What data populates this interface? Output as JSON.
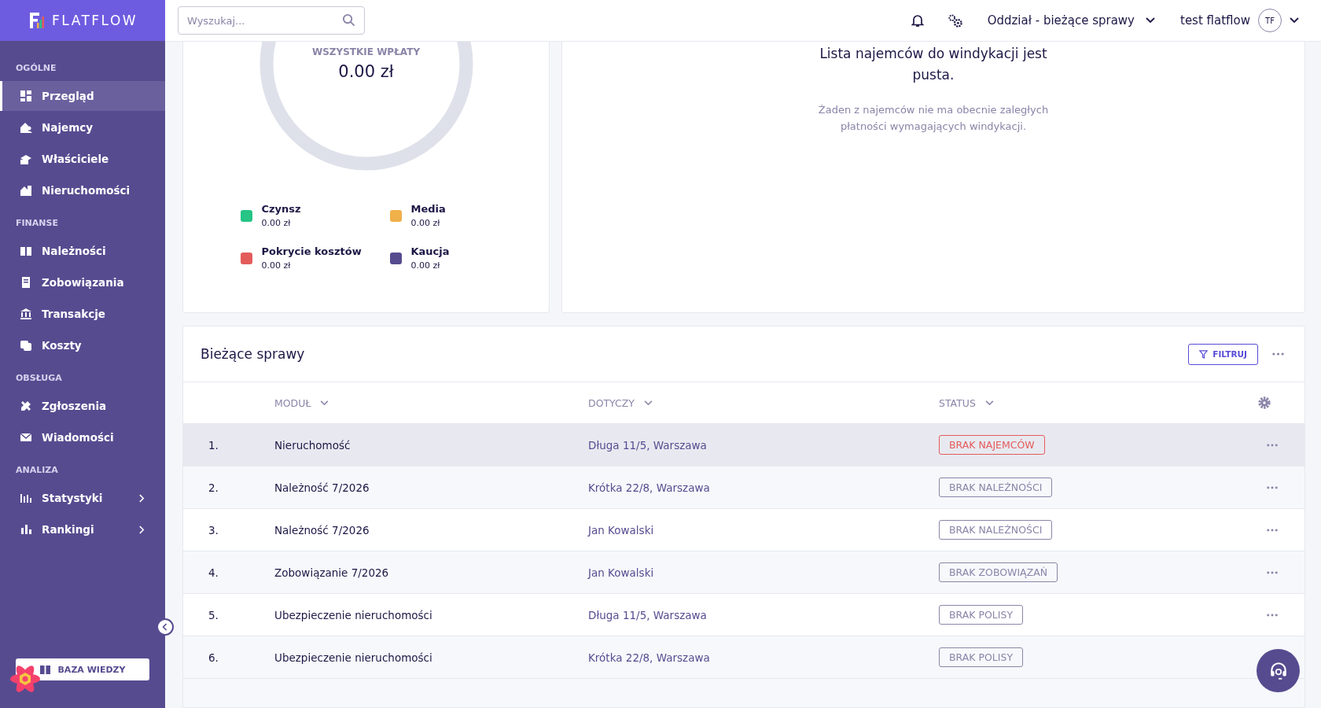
{
  "brand": "FLATFLOW",
  "sidebar": {
    "sections": [
      {
        "title": "OGÓLNE",
        "items": [
          {
            "label": "Przegląd",
            "selected": true,
            "submenu": false
          },
          {
            "label": "Najemcy",
            "selected": false,
            "submenu": false
          },
          {
            "label": "Właściciele",
            "selected": false,
            "submenu": false
          },
          {
            "label": "Nieruchomości",
            "selected": false,
            "submenu": false
          }
        ]
      },
      {
        "title": "FINANSE",
        "items": [
          {
            "label": "Należności",
            "selected": false,
            "submenu": false
          },
          {
            "label": "Zobowiązania",
            "selected": false,
            "submenu": false
          },
          {
            "label": "Transakcje",
            "selected": false,
            "submenu": false
          },
          {
            "label": "Koszty",
            "selected": false,
            "submenu": false
          }
        ]
      },
      {
        "title": "OBSŁUGA",
        "items": [
          {
            "label": "Zgłoszenia",
            "selected": false,
            "submenu": false
          },
          {
            "label": "Wiadomości",
            "selected": false,
            "submenu": false
          }
        ]
      },
      {
        "title": "ANALIZA",
        "items": [
          {
            "label": "Statystyki",
            "selected": false,
            "submenu": true
          },
          {
            "label": "Rankingi",
            "selected": false,
            "submenu": true
          }
        ]
      }
    ],
    "knowledge_button": "BAZA WIEDZY"
  },
  "topbar": {
    "search": {
      "placeholder": "Wyszukaj..."
    },
    "branch": "Oddział - bieżące sprawy",
    "user": "test flatflow",
    "avatar": "TF"
  },
  "payments": {
    "label": "WSZYSTKIE WPŁATY",
    "total": "0.00 zł",
    "legend": [
      {
        "name": "Czynsz",
        "amount": "0.00 zł",
        "color": "#26c485"
      },
      {
        "name": "Media",
        "amount": "0.00 zł",
        "color": "#f0b04a"
      },
      {
        "name": "Pokrycie kosztów",
        "amount": "0.00 zł",
        "color": "#e45b5b"
      },
      {
        "name": "Kaucja",
        "amount": "0.00 zł",
        "color": "#574b90"
      }
    ]
  },
  "collection": {
    "title": "Lista najemców do windykacji jest pusta.",
    "message": "Żaden z najemców nie ma obecnie zaległych płatności wymagających windykacji."
  },
  "cases": {
    "title": "Bieżące sprawy",
    "filter_button": "FILTRUJ",
    "columns": [
      "MODUŁ",
      "DOTYCZY",
      "STATUS"
    ],
    "rows": [
      {
        "no": "1.",
        "module": "Nieruchomość",
        "subject": "Długa 11/5, Warszawa",
        "status": "BRAK NAJEMCÓW",
        "kind": "alert",
        "selected": true
      },
      {
        "no": "2.",
        "module": "Należność 7/2026",
        "subject": "Krótka 22/8, Warszawa",
        "status": "BRAK NALEŻNOŚCI",
        "kind": "neutral",
        "selected": false
      },
      {
        "no": "3.",
        "module": "Należność 7/2026",
        "subject": "Jan Kowalski",
        "status": "BRAK NALEŻNOŚCI",
        "kind": "neutral",
        "selected": false
      },
      {
        "no": "4.",
        "module": "Zobowiązanie 7/2026",
        "subject": "Jan Kowalski",
        "status": "BRAK ZOBOWIĄZAŃ",
        "kind": "neutral",
        "selected": false
      },
      {
        "no": "5.",
        "module": "Ubezpieczenie nieruchomości",
        "subject": "Długa 11/5, Warszawa",
        "status": "BRAK POLISY",
        "kind": "neutral",
        "selected": false
      },
      {
        "no": "6.",
        "module": "Ubezpieczenie nieruchomości",
        "subject": "Krótka 22/8, Warszawa",
        "status": "BRAK POLISY",
        "kind": "neutral",
        "selected": false
      }
    ]
  }
}
